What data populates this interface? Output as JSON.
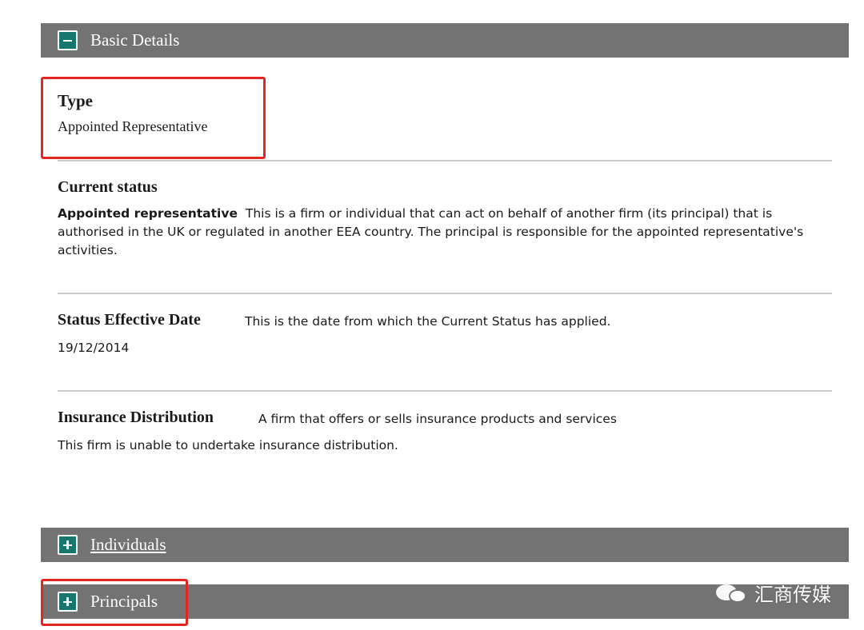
{
  "sections": {
    "basic_details": {
      "label": "Basic Details",
      "toggle": "minus-icon"
    },
    "individuals": {
      "label": "Individuals",
      "toggle": "plus-icon"
    },
    "principals": {
      "label": "Principals",
      "toggle": "plus-icon"
    }
  },
  "type": {
    "heading": "Type",
    "value": "Appointed Representative"
  },
  "current_status": {
    "heading": "Current status",
    "status_label": "Appointed representative",
    "description": "This is a firm or individual that can act on behalf of another firm (its principal) that is authorised in the UK or regulated in another EEA country. The principal is responsible for the appointed representative's activities."
  },
  "status_effective_date": {
    "heading": "Status Effective Date",
    "help": "This is the date from which the Current Status has applied.",
    "value": "19/12/2014"
  },
  "insurance_distribution": {
    "heading": "Insurance Distribution",
    "help": "A firm that offers or sells insurance products and services",
    "value": "This firm is unable to undertake insurance distribution."
  },
  "watermark": {
    "text": "汇商传媒",
    "icon": "wechat-icon"
  },
  "colors": {
    "bar": "#737373",
    "toggle": "#17776f",
    "highlight": "#e3261f"
  }
}
